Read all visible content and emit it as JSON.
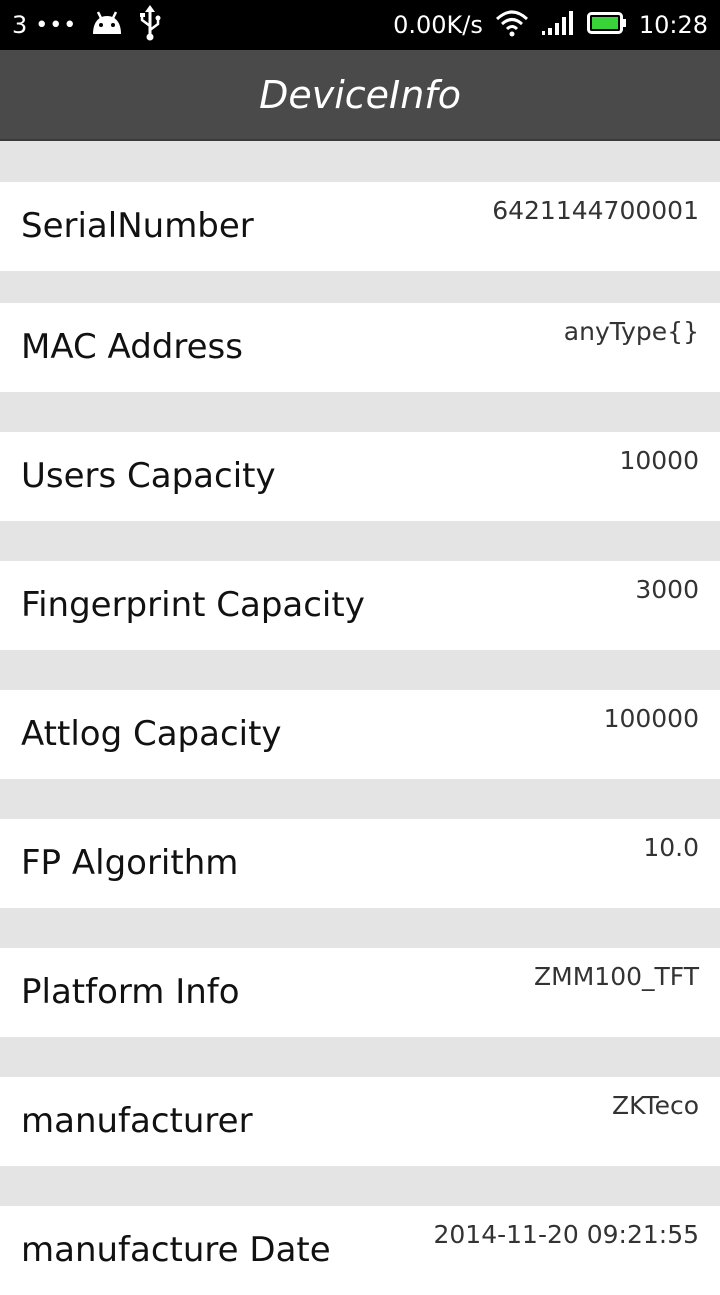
{
  "status_bar": {
    "sim_number": "3",
    "dots": "•••",
    "network_speed": "0.00K/s",
    "time": "10:28",
    "icons": [
      "android-icon",
      "usb-icon",
      "wifi-icon",
      "signal-icon",
      "battery-icon"
    ],
    "battery_color": "#3ad33a"
  },
  "action_bar": {
    "title": "DeviceInfo",
    "background": "#4a4a4a"
  },
  "rows": [
    {
      "label": "SerialNumber",
      "value": "6421144700001"
    },
    {
      "label": "MAC Address",
      "value": "anyType{}"
    },
    {
      "label": "Users Capacity",
      "value": "10000"
    },
    {
      "label": "Fingerprint Capacity",
      "value": "3000"
    },
    {
      "label": "Attlog Capacity",
      "value": "100000"
    },
    {
      "label": "FP Algorithm",
      "value": "10.0"
    },
    {
      "label": "Platform Info",
      "value": "ZMM100_TFT"
    },
    {
      "label": "manufacturer",
      "value": "ZKTeco"
    },
    {
      "label": "manufacture Date",
      "value": "2014-11-20 09:21:55"
    }
  ]
}
